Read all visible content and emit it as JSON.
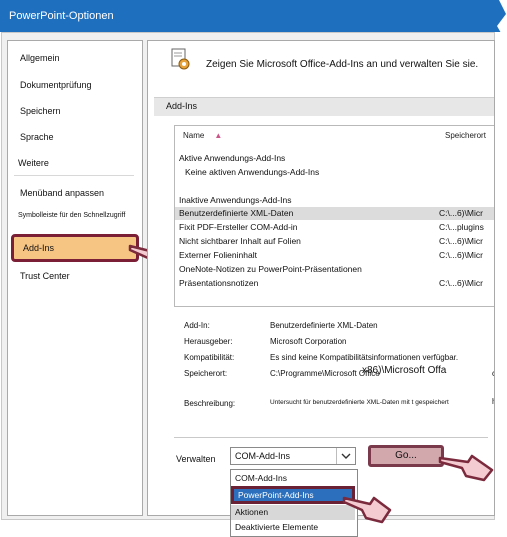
{
  "window": {
    "title": "PowerPoint-Optionen"
  },
  "sidebar": {
    "items": [
      {
        "label": "Allgemein"
      },
      {
        "label": "Dokumentprüfung"
      },
      {
        "label": "Speichern"
      },
      {
        "label": "Sprache"
      },
      {
        "label": "Weitere"
      },
      {
        "label": "Menüband anpassen"
      },
      {
        "label": "Symbolleiste für den Schnellzugriff"
      },
      {
        "label": "Add-Ins"
      },
      {
        "label": "Trust Center"
      }
    ],
    "active": "Add-Ins"
  },
  "main": {
    "header": "Zeigen Sie Microsoft Office-Add-Ins an und verwalten Sie sie.",
    "section": "Add-Ins",
    "columns": {
      "name": "Name",
      "location": "Speicherort"
    },
    "rows": [
      {
        "name": "Aktive Anwendungs-Add-Ins",
        "loc": ""
      },
      {
        "name": "Keine aktiven Anwendungs-Add-Ins",
        "loc": ""
      },
      {
        "name": "Inaktive Anwendungs-Add-Ins",
        "loc": ""
      },
      {
        "name": "Benutzerdefinierte XML-Daten",
        "loc": "C:\\...6)\\Micr"
      },
      {
        "name": "Fixit PDF-Ersteller COM-Add-in",
        "loc": "C:\\...plugins"
      },
      {
        "name": "Nicht sichtbarer Inhalt auf Folien",
        "loc": "C:\\...6)\\Micr"
      },
      {
        "name": "Externer Folieninhalt",
        "loc": "C:\\...6)\\Micr"
      },
      {
        "name": "OneNote-Notizen zu PowerPoint-Präsentationen",
        "loc": ""
      },
      {
        "name": "Präsentationsnotizen",
        "loc": "C:\\...6)\\Micr"
      }
    ],
    "details": {
      "addin_label": "Add-In:",
      "addin_value": "Benutzerdefinierte XML-Daten",
      "publisher_label": "Herausgeber:",
      "publisher_value": "Microsoft Corporation",
      "compat_label": "Kompatibilität:",
      "compat_value": "Es sind keine Kompatibilitätsinformationen verfügbar.",
      "location_label": "Speicherort:",
      "location_value": "C:\\Programme\\Microsoft Office",
      "location_overlap": "x86)\\Microsoft Offa",
      "location_tail": "c",
      "desc_label": "Beschreibung:",
      "desc_value": "Untersucht für benutzerdefinierte XML-Daten mit t gespeichert",
      "desc_tail": "hi"
    },
    "manage": {
      "label": "Verwalten",
      "selected": "COM-Add-Ins",
      "go_button": "Go...",
      "options": [
        "COM-Add-Ins",
        "PowerPoint-Add-Ins",
        "Aktionen",
        "Deaktivierte Elemente"
      ]
    }
  }
}
